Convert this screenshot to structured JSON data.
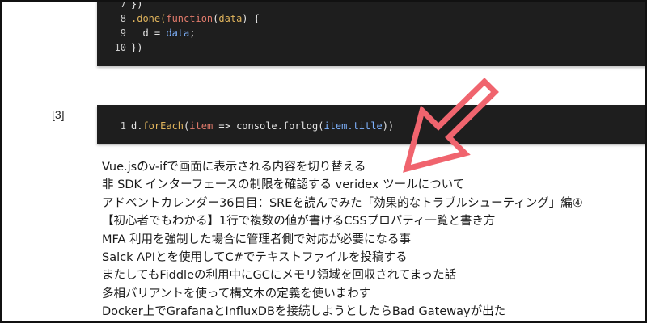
{
  "code_block_1": {
    "lines": [
      {
        "num": "7",
        "text": "})"
      },
      {
        "num": "8",
        "a": ".done(",
        "b": "function",
        "c": "(",
        "d": "data",
        "e": ") {"
      },
      {
        "num": "9",
        "f": "  d = ",
        "g": "data",
        "h": ";"
      },
      {
        "num": "10",
        "text": "})"
      }
    ]
  },
  "reference": {
    "label": "[3]"
  },
  "code_block_2": {
    "num": "1",
    "p1": "d.",
    "p2": "forEach",
    "p3": "(",
    "p4": "item",
    "p5": " => console.forlog(",
    "p6": "item.title",
    "p7": "))"
  },
  "links": [
    "Vue.jsのv-ifで画面に表示される内容を切り替える",
    "非 SDK インターフェースの制限を確認する veridex ツールについて",
    "アドベントカレンダー36日目：SREを読んでみた「効果的なトラブルシューティング」編④",
    "【初心者でもわかる】1行で複数の値が書けるCSSプロパティ一覧と書き方",
    "MFA 利用を強制した場合に管理者側で対応が必要になる事",
    "Salck APIとを使用してC#でテキストファイルを投稿する",
    "またしてもFiddleの利用中にGCにメモリ領域を回収されてまった話",
    "多相バリアントを使って構文木の定義を使いまわす",
    "Docker上でGrafanaとInfluxDBを接続しようとしたらBad Gatewayが出た"
  ],
  "colors": {
    "arrow": "#f0646e",
    "code_bg": "#1e1e1e"
  },
  "icons": {
    "annotation": "arrow-annotation-icon"
  }
}
